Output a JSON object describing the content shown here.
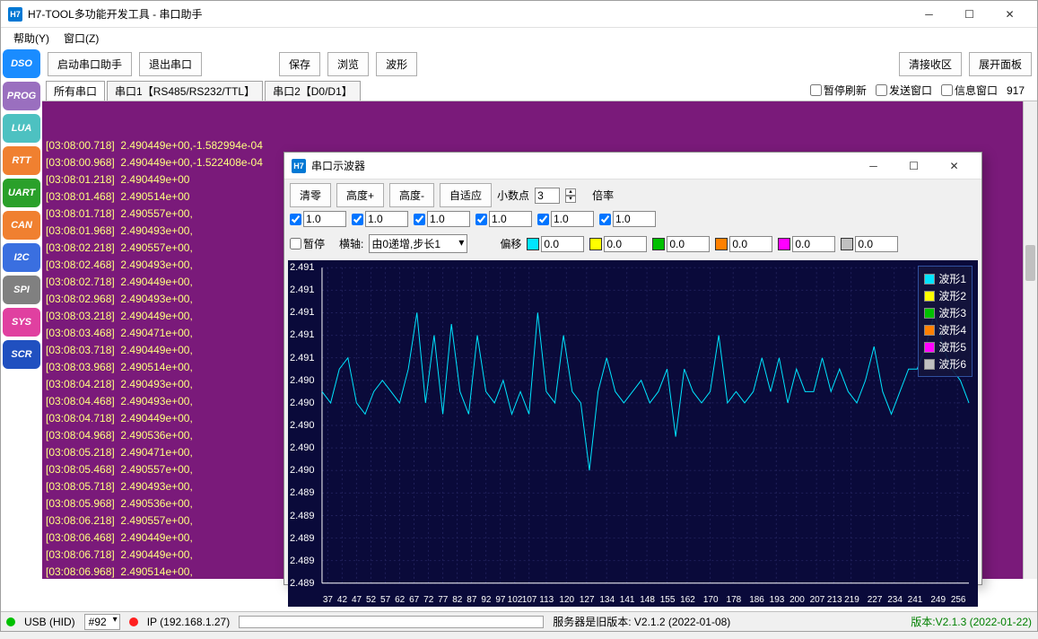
{
  "main": {
    "title": "H7-TOOL多功能开发工具 - 串口助手",
    "icon_text": "H7",
    "menu": {
      "help": "帮助(Y)",
      "window": "窗口(Z)"
    },
    "toolbar": {
      "open": "启动串口助手",
      "exit": "退出串口",
      "save": "保存",
      "browse": "浏览",
      "wave": "波形",
      "clear_rx": "清接收区",
      "expand": "展开面板"
    },
    "tabs": {
      "all": "所有串口",
      "port1": "串口1【RS485/RS232/TTL】",
      "port2": "串口2【D0/D1】"
    },
    "checks": {
      "pause": "暂停刷新",
      "send_win": "发送窗口",
      "info_win": "信息窗口"
    },
    "count": "917"
  },
  "sidebar": {
    "items": [
      {
        "label": "DSO",
        "color": "#1a8cff"
      },
      {
        "label": "PROG",
        "color": "#9a6fbf"
      },
      {
        "label": "LUA",
        "color": "#4dc1c1"
      },
      {
        "label": "RTT",
        "color": "#f08030"
      },
      {
        "label": "UART",
        "color": "#2aa02a"
      },
      {
        "label": "CAN",
        "color": "#f08030"
      },
      {
        "label": "I2C",
        "color": "#3a6fe0"
      },
      {
        "label": "SPI",
        "color": "#808080"
      },
      {
        "label": "SYS",
        "color": "#e040a0"
      },
      {
        "label": "SCR",
        "color": "#2050c0"
      }
    ]
  },
  "console_lines": [
    "[03:08:00.718]  2.490449e+00,-1.582994e-04",
    "[03:08:00.968]  2.490449e+00,-1.522408e-04",
    "[03:08:01.218]  2.490449e+00",
    "[03:08:01.468]  2.490514e+00",
    "[03:08:01.718]  2.490557e+00,",
    "[03:08:01.968]  2.490493e+00,",
    "[03:08:02.218]  2.490557e+00,",
    "[03:08:02.468]  2.490493e+00,",
    "[03:08:02.718]  2.490449e+00,",
    "[03:08:02.968]  2.490493e+00,",
    "[03:08:03.218]  2.490449e+00,",
    "[03:08:03.468]  2.490471e+00,",
    "[03:08:03.718]  2.490449e+00,",
    "[03:08:03.968]  2.490514e+00,",
    "[03:08:04.218]  2.490493e+00,",
    "[03:08:04.468]  2.490493e+00,",
    "[03:08:04.718]  2.490449e+00,",
    "[03:08:04.968]  2.490536e+00,",
    "[03:08:05.218]  2.490471e+00,",
    "[03:08:05.468]  2.490557e+00,",
    "[03:08:05.718]  2.490493e+00,",
    "[03:08:05.968]  2.490536e+00,",
    "[03:08:06.218]  2.490557e+00,",
    "[03:08:06.468]  2.490449e+00,",
    "[03:08:06.718]  2.490449e+00,",
    "[03:08:06.968]  2.490514e+00,"
  ],
  "status": {
    "usb_label": "USB (HID)",
    "device_sel": "#92",
    "ip_label": "IP (192.168.1.27)",
    "server_msg": "服务器是旧版本: V2.1.2 (2022-01-08)",
    "version": "版本:V2.1.3 (2022-01-22)"
  },
  "scope": {
    "title": "串口示波器",
    "icon_text": "H7",
    "toolbar": {
      "clear": "清零",
      "height_plus": "高度+",
      "height_minus": "高度-",
      "autofit": "自适应",
      "decimals_lbl": "小数点",
      "decimals_val": "3",
      "pause_lbl": "暂停",
      "xaxis_lbl": "横轴:",
      "xaxis_sel": "由0递增,步长1",
      "mult_lbl": "倍率",
      "offset_lbl": "偏移"
    },
    "channels": [
      {
        "color": "#00e5ff",
        "mult": "1.0",
        "offset": "0.0",
        "name": "波形1"
      },
      {
        "color": "#ffff00",
        "mult": "1.0",
        "offset": "0.0",
        "name": "波形2"
      },
      {
        "color": "#00c000",
        "mult": "1.0",
        "offset": "0.0",
        "name": "波形3"
      },
      {
        "color": "#ff8000",
        "mult": "1.0",
        "offset": "0.0",
        "name": "波形4"
      },
      {
        "color": "#ff00ff",
        "mult": "1.0",
        "offset": "0.0",
        "name": "波形5"
      },
      {
        "color": "#c0c0c0",
        "mult": "1.0",
        "offset": "0.0",
        "name": "波形6"
      }
    ]
  },
  "chart_data": {
    "type": "line",
    "title": "",
    "xlabel": "",
    "ylabel": "",
    "xlim": [
      35,
      260
    ],
    "ylim": [
      2.4886,
      2.4914
    ],
    "yticks": [
      2.491,
      2.491,
      2.491,
      2.491,
      2.491,
      2.49,
      2.49,
      2.49,
      2.49,
      2.49,
      2.489,
      2.489,
      2.489,
      2.489,
      2.489
    ],
    "xticks": [
      37,
      42,
      47,
      52,
      57,
      62,
      67,
      72,
      77,
      82,
      87,
      92,
      97,
      102,
      107,
      113,
      120,
      127,
      134,
      141,
      148,
      155,
      162,
      170,
      178,
      186,
      193,
      200,
      207,
      213,
      219,
      227,
      234,
      241,
      249,
      256
    ],
    "series": [
      {
        "name": "波形1",
        "color": "#00e5ff",
        "x": [
          35,
          38,
          41,
          44,
          47,
          50,
          53,
          56,
          59,
          62,
          65,
          68,
          71,
          74,
          77,
          80,
          83,
          86,
          89,
          92,
          95,
          98,
          101,
          104,
          107,
          110,
          113,
          116,
          119,
          122,
          125,
          128,
          131,
          134,
          137,
          140,
          143,
          146,
          149,
          152,
          155,
          158,
          161,
          164,
          167,
          170,
          173,
          176,
          179,
          182,
          185,
          188,
          191,
          194,
          197,
          200,
          203,
          206,
          209,
          212,
          215,
          218,
          221,
          224,
          227,
          230,
          233,
          236,
          239,
          242,
          245,
          248,
          251,
          254,
          257,
          260
        ],
        "y": [
          2.4903,
          2.4902,
          2.4905,
          2.4906,
          2.4902,
          2.4901,
          2.4903,
          2.4904,
          2.4903,
          2.4902,
          2.4905,
          2.491,
          2.4902,
          2.4908,
          2.4901,
          2.4909,
          2.4903,
          2.4901,
          2.4908,
          2.4903,
          2.4902,
          2.4904,
          2.4901,
          2.4903,
          2.4901,
          2.491,
          2.4903,
          2.4902,
          2.4908,
          2.4903,
          2.4902,
          2.4896,
          2.4903,
          2.4906,
          2.4903,
          2.4902,
          2.4903,
          2.4904,
          2.4902,
          2.4903,
          2.4905,
          2.4899,
          2.4905,
          2.4903,
          2.4902,
          2.4903,
          2.4908,
          2.4902,
          2.4903,
          2.4902,
          2.4903,
          2.4906,
          2.4903,
          2.4906,
          2.4902,
          2.4905,
          2.4903,
          2.4903,
          2.4906,
          2.4903,
          2.4905,
          2.4903,
          2.4902,
          2.4904,
          2.4907,
          2.4903,
          2.4901,
          2.4903,
          2.4905,
          2.4905,
          2.4907,
          2.491,
          2.4907,
          2.4905,
          2.4904,
          2.4902
        ]
      }
    ]
  }
}
